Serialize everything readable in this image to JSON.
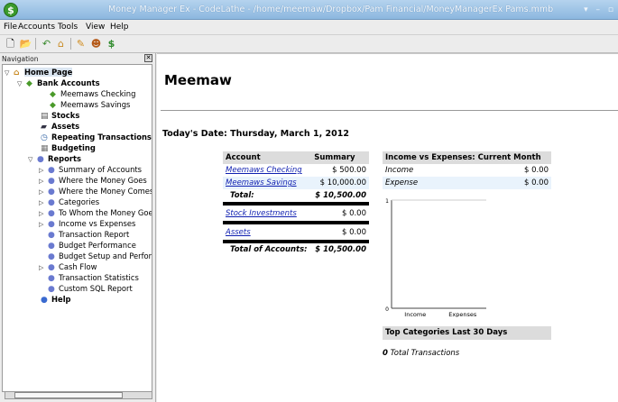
{
  "window": {
    "title": "Money Manager Ex - CodeLathe - /home/meemaw/Dropbox/Pam Financial/MoneyManagerEx Pams.mmb",
    "app_icon_letter": "$",
    "controls": "▾ – ▫"
  },
  "menu": [
    "File",
    "Accounts",
    "Tools",
    "View",
    "Help"
  ],
  "toolbar_icons": [
    "new-document-icon",
    "open-folder-icon",
    "home-icon",
    "up-icon",
    "pencil-icon",
    "users-icon",
    "dollar-icon"
  ],
  "nav": {
    "header": "Navigation",
    "close": "✕",
    "items": [
      {
        "label": "Home Page",
        "bold": true
      },
      {
        "label": "Bank Accounts",
        "bold": true
      },
      {
        "label": "Meemaws Checking",
        "bold": false
      },
      {
        "label": "Meemaws Savings",
        "bold": false
      },
      {
        "label": "Stocks",
        "bold": true
      },
      {
        "label": "Assets",
        "bold": true
      },
      {
        "label": "Repeating Transactions",
        "bold": true
      },
      {
        "label": "Budgeting",
        "bold": true
      },
      {
        "label": "Reports",
        "bold": true
      },
      {
        "label": "Summary of Accounts",
        "bold": false
      },
      {
        "label": "Where the Money Goes",
        "bold": false
      },
      {
        "label": "Where the Money Comes Fr",
        "bold": false
      },
      {
        "label": "Categories",
        "bold": false
      },
      {
        "label": "To Whom the Money Goes",
        "bold": false
      },
      {
        "label": "Income vs Expenses",
        "bold": false
      },
      {
        "label": "Transaction Report",
        "bold": false
      },
      {
        "label": "Budget Performance",
        "bold": false
      },
      {
        "label": "Budget Setup and Performa",
        "bold": false
      },
      {
        "label": "Cash Flow",
        "bold": false
      },
      {
        "label": "Transaction Statistics",
        "bold": false
      },
      {
        "label": "Custom SQL Report",
        "bold": false
      },
      {
        "label": "Help",
        "bold": true
      }
    ]
  },
  "main": {
    "title": "Meemaw",
    "today": "Today's Date: Thursday, March 1, 2012",
    "accounts_table": {
      "headers": [
        "Account",
        "Summary"
      ],
      "rows": [
        {
          "name": "Meemaws Checking",
          "value": "$ 500.00"
        },
        {
          "name": "Meemaws Savings",
          "value": "$ 10,000.00"
        }
      ],
      "total_label": "Total:",
      "total_value": "$ 10,500.00",
      "stock_label": "Stock Investments",
      "stock_value": "$ 0.00",
      "assets_label": "Assets",
      "assets_value": "$ 0.00",
      "grand_total_label": "Total of Accounts:",
      "grand_total_value": "$ 10,500.00"
    },
    "income_expense": {
      "header": "Income vs Expenses: Current Month",
      "rows": [
        {
          "label": "Income",
          "value": "$ 0.00"
        },
        {
          "label": "Expense",
          "value": "$ 0.00"
        }
      ]
    },
    "top_categories_header": "Top Categories Last 30 Days",
    "total_transactions_count": "0",
    "total_transactions_label": "Total Transactions"
  },
  "chart_data": {
    "type": "bar",
    "categories": [
      "Income",
      "Expenses"
    ],
    "values": [
      0,
      0
    ],
    "ylim": [
      0,
      1
    ],
    "ytick_labels": [
      "1",
      "0"
    ],
    "title": "",
    "xlabel": "",
    "ylabel": ""
  }
}
